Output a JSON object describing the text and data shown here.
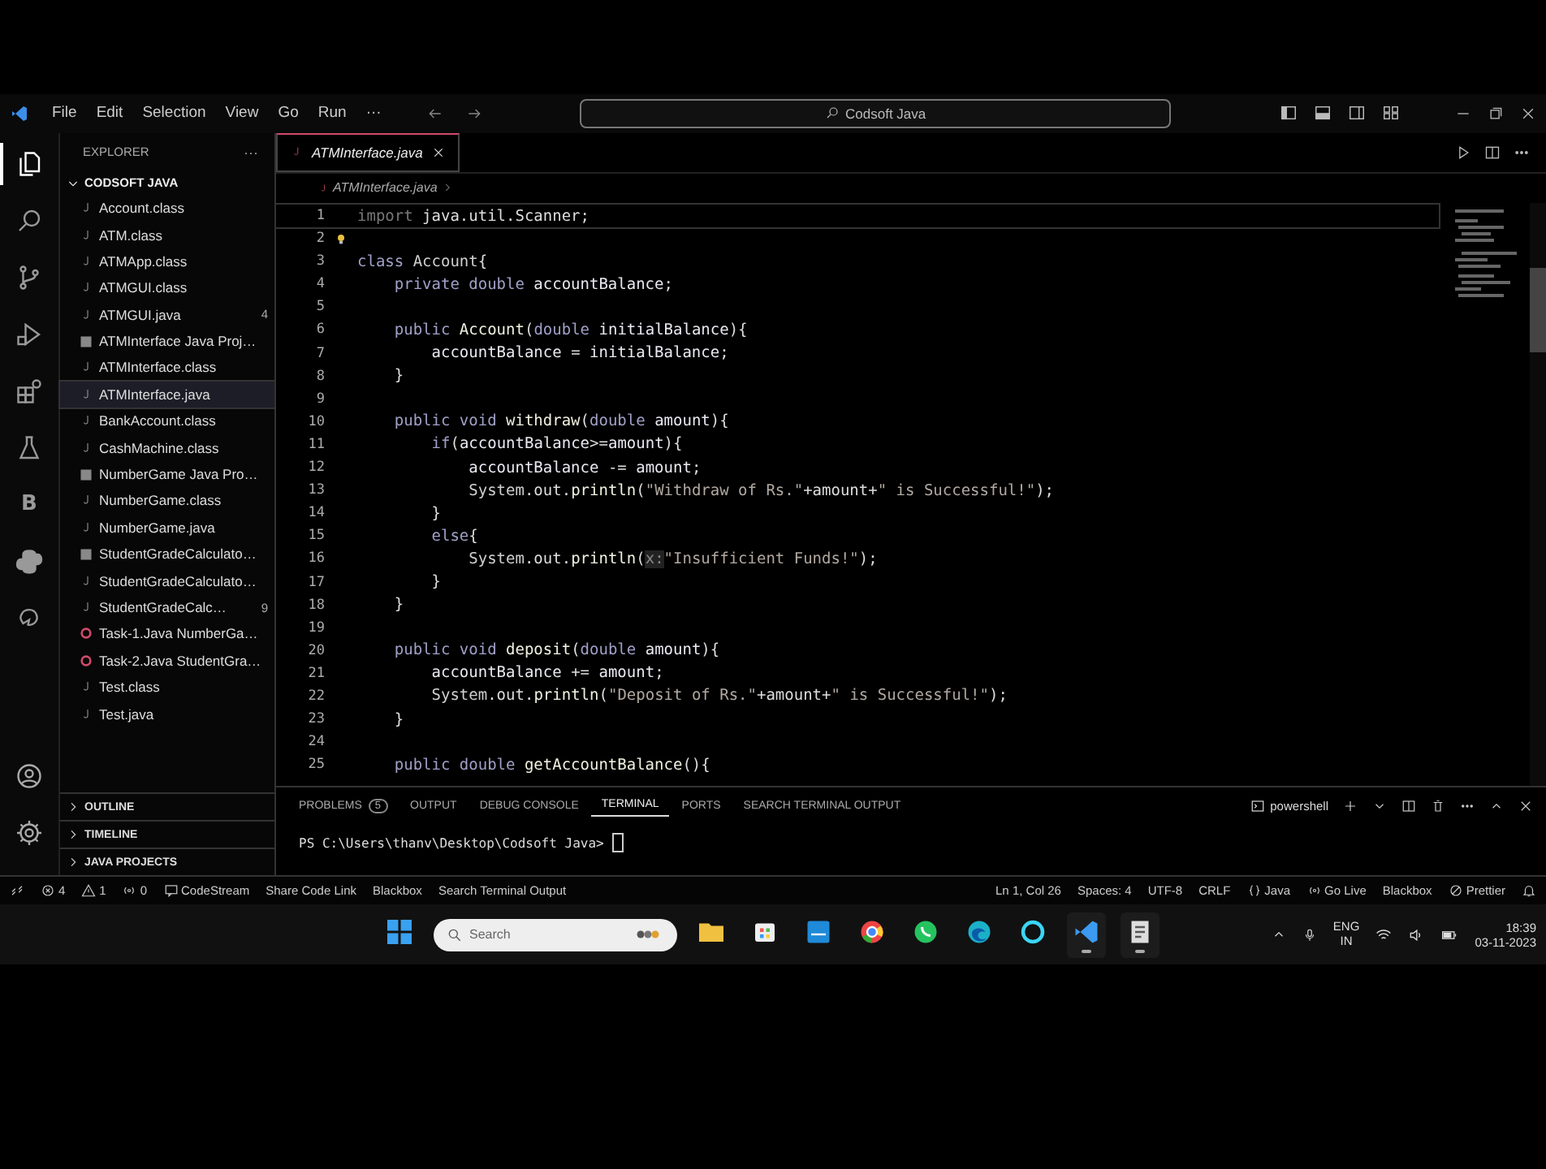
{
  "title_bar": {
    "menu": [
      "File",
      "Edit",
      "Selection",
      "View",
      "Go",
      "Run",
      "···"
    ],
    "search": "Codsoft Java"
  },
  "activity_bar": {
    "top": [
      {
        "kind": "files",
        "selected": true
      },
      {
        "kind": "search",
        "selected": false
      },
      {
        "kind": "branch",
        "selected": false
      },
      {
        "kind": "run",
        "selected": false
      },
      {
        "kind": "extensions",
        "selected": false
      },
      {
        "kind": "flask",
        "selected": false
      },
      {
        "kind": "letter",
        "text": "B",
        "selected": false
      },
      {
        "kind": "python",
        "selected": false
      },
      {
        "kind": "hook",
        "selected": false
      }
    ],
    "bottom": [
      {
        "kind": "account"
      },
      {
        "kind": "gear"
      }
    ]
  },
  "sidebar": {
    "title": "EXPLORER",
    "more": "···",
    "folder": "CODSOFT JAVA",
    "items": [
      {
        "name": "Account.class",
        "kind": "java",
        "selected": false
      },
      {
        "name": "ATM.class",
        "kind": "java",
        "selected": false
      },
      {
        "name": "ATMApp.class",
        "kind": "java",
        "selected": false
      },
      {
        "name": "ATMGUI.class",
        "kind": "java",
        "selected": false
      },
      {
        "name": "ATMGUI.java",
        "kind": "java",
        "selected": false,
        "badge": "4"
      },
      {
        "name": "ATMInterface Java Proj…",
        "kind": "project",
        "selected": false
      },
      {
        "name": "ATMInterface.class",
        "kind": "java",
        "selected": false
      },
      {
        "name": "ATMInterface.java",
        "kind": "java",
        "selected": true
      },
      {
        "name": "BankAccount.class",
        "kind": "java",
        "selected": false
      },
      {
        "name": "CashMachine.class",
        "kind": "java",
        "selected": false
      },
      {
        "name": "NumberGame Java Pro…",
        "kind": "project",
        "selected": false
      },
      {
        "name": "NumberGame.class",
        "kind": "java",
        "selected": false
      },
      {
        "name": "NumberGame.java",
        "kind": "java",
        "selected": false
      },
      {
        "name": "StudentGradeCalculato…",
        "kind": "project",
        "selected": false
      },
      {
        "name": "StudentGradeCalculato…",
        "kind": "java",
        "selected": false
      },
      {
        "name": "StudentGradeCalc…",
        "kind": "java",
        "selected": false,
        "badge": "9"
      },
      {
        "name": "Task-1.Java NumberGa…",
        "kind": "error",
        "selected": false
      },
      {
        "name": "Task-2.Java StudentGra…",
        "kind": "error",
        "selected": false
      },
      {
        "name": "Test.class",
        "kind": "java",
        "selected": false
      },
      {
        "name": "Test.java",
        "kind": "java",
        "selected": false
      }
    ],
    "sections": [
      "OUTLINE",
      "TIMELINE",
      "JAVA PROJECTS"
    ]
  },
  "editor": {
    "tabs": [
      {
        "label": "ATMInterface.java",
        "selected": true
      }
    ],
    "breadcrumb": "ATMInterface.java",
    "lines": [
      {
        "number": "1",
        "tokens": [
          {
            "kind": "dim",
            "text": "import"
          },
          {
            "kind": "plain",
            "text": " java.util.Scanner;"
          }
        ]
      },
      {
        "number": "2",
        "lightbulb": true
      },
      {
        "number": "3",
        "tokens": [
          {
            "kind": "keyword",
            "text": "class"
          },
          {
            "kind": "type",
            "text": " Account"
          },
          {
            "kind": "plain",
            "text": "{"
          }
        ]
      },
      {
        "number": "4",
        "tokens": [
          {
            "kind": "keyword",
            "text": "    private double"
          },
          {
            "kind": "var",
            "text": " accountBalance"
          },
          {
            "kind": "plain",
            "text": ";"
          }
        ]
      },
      {
        "number": "5"
      },
      {
        "number": "6",
        "tokens": [
          {
            "kind": "keyword",
            "text": "    public"
          },
          {
            "kind": "fn",
            "text": " Account"
          },
          {
            "kind": "plain",
            "text": "("
          },
          {
            "kind": "keyword",
            "text": "double"
          },
          {
            "kind": "var",
            "text": " initialBalance"
          },
          {
            "kind": "plain",
            "text": "){"
          }
        ]
      },
      {
        "number": "7",
        "tokens": [
          {
            "kind": "var",
            "text": "        accountBalance"
          },
          {
            "kind": "plain",
            "text": " = "
          },
          {
            "kind": "var",
            "text": "initialBalance"
          },
          {
            "kind": "plain",
            "text": ";"
          }
        ]
      },
      {
        "number": "8",
        "tokens": [
          {
            "kind": "plain",
            "text": "    }"
          }
        ]
      },
      {
        "number": "9"
      },
      {
        "number": "10",
        "tokens": [
          {
            "kind": "keyword",
            "text": "    public void"
          },
          {
            "kind": "fn",
            "text": " withdraw"
          },
          {
            "kind": "plain",
            "text": "("
          },
          {
            "kind": "keyword",
            "text": "double"
          },
          {
            "kind": "var",
            "text": " amount"
          },
          {
            "kind": "plain",
            "text": "){"
          }
        ]
      },
      {
        "number": "11",
        "tokens": [
          {
            "kind": "keyword",
            "text": "        if"
          },
          {
            "kind": "plain",
            "text": "("
          },
          {
            "kind": "var",
            "text": "accountBalance"
          },
          {
            "kind": "plain",
            "text": ">="
          },
          {
            "kind": "var",
            "text": "amount"
          },
          {
            "kind": "plain",
            "text": "){"
          }
        ]
      },
      {
        "number": "12",
        "tokens": [
          {
            "kind": "var",
            "text": "            accountBalance"
          },
          {
            "kind": "plain",
            "text": " -= "
          },
          {
            "kind": "var",
            "text": "amount"
          },
          {
            "kind": "plain",
            "text": ";"
          }
        ]
      },
      {
        "number": "13",
        "tokens": [
          {
            "kind": "type",
            "text": "            System"
          },
          {
            "kind": "plain",
            "text": ".out."
          },
          {
            "kind": "fn",
            "text": "println"
          },
          {
            "kind": "plain",
            "text": "("
          },
          {
            "kind": "str",
            "text": "\"Withdraw of Rs.\""
          },
          {
            "kind": "plain",
            "text": "+amount+"
          },
          {
            "kind": "str",
            "text": "\" is Successful!\""
          },
          {
            "kind": "plain",
            "text": ");"
          }
        ]
      },
      {
        "number": "14",
        "tokens": [
          {
            "kind": "plain",
            "text": "        }"
          }
        ]
      },
      {
        "number": "15",
        "tokens": [
          {
            "kind": "keyword",
            "text": "        else"
          },
          {
            "kind": "plain",
            "text": "{"
          }
        ]
      },
      {
        "number": "16",
        "tokens": [
          {
            "kind": "type",
            "text": "            System"
          },
          {
            "kind": "plain",
            "text": ".out."
          },
          {
            "kind": "fn",
            "text": "println"
          },
          {
            "kind": "plain",
            "text": "("
          },
          {
            "kind": "hint",
            "text": "x:"
          },
          {
            "kind": "str",
            "text": "\"Insufficient Funds!\""
          },
          {
            "kind": "plain",
            "text": ");"
          }
        ]
      },
      {
        "number": "17",
        "tokens": [
          {
            "kind": "plain",
            "text": "        }"
          }
        ]
      },
      {
        "number": "18",
        "tokens": [
          {
            "kind": "plain",
            "text": "    }"
          }
        ]
      },
      {
        "number": "19"
      },
      {
        "number": "20",
        "tokens": [
          {
            "kind": "keyword",
            "text": "    public void"
          },
          {
            "kind": "fn",
            "text": " deposit"
          },
          {
            "kind": "plain",
            "text": "("
          },
          {
            "kind": "keyword",
            "text": "double"
          },
          {
            "kind": "var",
            "text": " amount"
          },
          {
            "kind": "plain",
            "text": "){"
          }
        ]
      },
      {
        "number": "21",
        "tokens": [
          {
            "kind": "var",
            "text": "        accountBalance"
          },
          {
            "kind": "plain",
            "text": " += "
          },
          {
            "kind": "var",
            "text": "amount"
          },
          {
            "kind": "plain",
            "text": ";"
          }
        ]
      },
      {
        "number": "22",
        "tokens": [
          {
            "kind": "type",
            "text": "        System"
          },
          {
            "kind": "plain",
            "text": ".out."
          },
          {
            "kind": "fn",
            "text": "println"
          },
          {
            "kind": "plain",
            "text": "("
          },
          {
            "kind": "str",
            "text": "\"Deposit of Rs.\""
          },
          {
            "kind": "plain",
            "text": "+amount+"
          },
          {
            "kind": "str",
            "text": "\" is Successful!\""
          },
          {
            "kind": "plain",
            "text": ");"
          }
        ]
      },
      {
        "number": "23",
        "tokens": [
          {
            "kind": "plain",
            "text": "    }"
          }
        ]
      },
      {
        "number": "24"
      },
      {
        "number": "25",
        "tokens": [
          {
            "kind": "keyword",
            "text": "    public double"
          },
          {
            "kind": "fn",
            "text": " getAccountBalance"
          },
          {
            "kind": "plain",
            "text": "(){"
          }
        ]
      }
    ]
  },
  "panel": {
    "tabs": [
      {
        "label": "PROBLEMS",
        "badge": "5",
        "selected": false
      },
      {
        "label": "OUTPUT",
        "selected": false
      },
      {
        "label": "DEBUG CONSOLE",
        "selected": false
      },
      {
        "label": "TERMINAL",
        "selected": true
      },
      {
        "label": "PORTS",
        "selected": false
      },
      {
        "label": "SEARCH TERMINAL OUTPUT",
        "selected": false
      }
    ],
    "shell": "powershell",
    "prompt": "PS C:\\Users\\thanv\\Desktop\\Codsoft Java>"
  },
  "status_bar": {
    "left": [
      {
        "kind": "remote"
      },
      {
        "kind": "error",
        "text": "4"
      },
      {
        "kind": "warning",
        "text": "1"
      },
      {
        "kind": "radio",
        "text": "0"
      },
      {
        "kind": "codestream",
        "text": "CodeStream"
      },
      {
        "kind": "plain",
        "text": "Share Code Link"
      },
      {
        "kind": "plain",
        "text": "Blackbox"
      },
      {
        "kind": "plain",
        "text": "Search Terminal Output"
      }
    ],
    "right": [
      {
        "kind": "plain",
        "text": "Ln 1, Col 26"
      },
      {
        "kind": "plain",
        "text": "Spaces: 4"
      },
      {
        "kind": "plain",
        "text": "UTF-8"
      },
      {
        "kind": "plain",
        "text": "CRLF"
      },
      {
        "kind": "braces",
        "text": "Java"
      },
      {
        "kind": "broadcast",
        "text": "Go Live"
      },
      {
        "kind": "plain",
        "text": "Blackbox"
      },
      {
        "kind": "prohibit",
        "text": "Prettier"
      },
      {
        "kind": "bell"
      }
    ]
  },
  "taskbar": {
    "search_placeholder": "Search",
    "apps": [
      {
        "kind": "windows",
        "running": false
      },
      {
        "kind": "folder",
        "running": false
      },
      {
        "kind": "store",
        "running": false
      },
      {
        "kind": "tile",
        "running": false
      },
      {
        "kind": "chrome",
        "running": false
      },
      {
        "kind": "whatsapp",
        "running": false
      },
      {
        "kind": "edge",
        "running": false
      },
      {
        "kind": "ring",
        "running": false
      },
      {
        "kind": "vscode",
        "running": true
      },
      {
        "kind": "notepad",
        "running": true
      }
    ],
    "language": "ENG",
    "region": "IN",
    "time": "18:39",
    "date": "03-11-2023"
  }
}
